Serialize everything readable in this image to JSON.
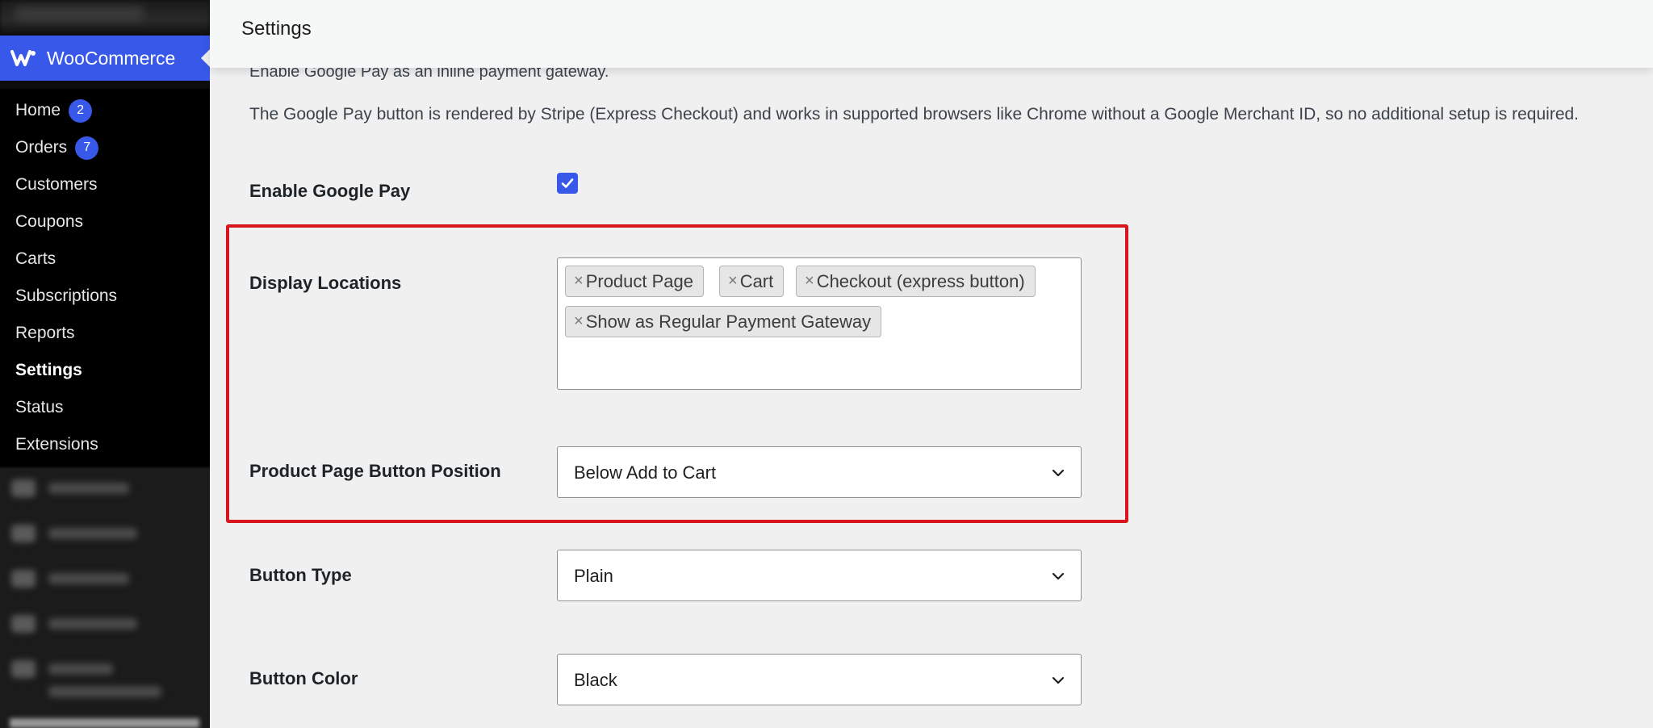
{
  "sidebar": {
    "brand": "WooCommerce",
    "items": [
      {
        "label": "Home",
        "badge": "2"
      },
      {
        "label": "Orders",
        "badge": "7"
      },
      {
        "label": "Customers"
      },
      {
        "label": "Coupons"
      },
      {
        "label": "Carts"
      },
      {
        "label": "Subscriptions"
      },
      {
        "label": "Reports"
      },
      {
        "label": "Settings",
        "active": true
      },
      {
        "label": "Status"
      },
      {
        "label": "Extensions"
      }
    ]
  },
  "header": {
    "title": "Settings"
  },
  "main": {
    "description_1": "Enable Google Pay as an inline payment gateway.",
    "description_2": "The Google Pay button is rendered by Stripe (Express Checkout) and works in supported browsers like Chrome without a Google Merchant ID, so no additional setup is required.",
    "enable_google_pay": {
      "label": "Enable Google Pay",
      "checked": true
    },
    "display_locations": {
      "label": "Display Locations",
      "tags": [
        "Product Page",
        "Cart",
        "Checkout (express button)",
        "Show as Regular Payment Gateway"
      ],
      "remove_glyph": "×"
    },
    "product_page_button_position": {
      "label": "Product Page Button Position",
      "value": "Below Add to Cart"
    },
    "button_type": {
      "label": "Button Type",
      "value": "Plain"
    },
    "button_color": {
      "label": "Button Color",
      "value": "Black"
    }
  },
  "colors": {
    "accent": "#3858e9",
    "highlight": "#d9141c",
    "sidebar_bg": "#000000"
  }
}
